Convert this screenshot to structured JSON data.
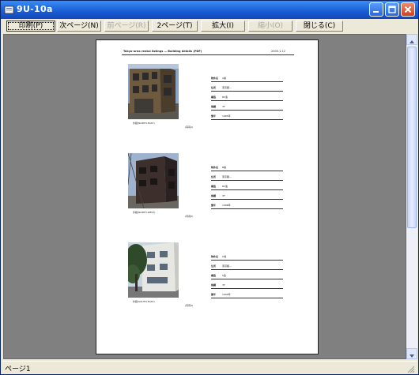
{
  "window": {
    "title": "9U-10a"
  },
  "toolbar": {
    "buttons": [
      {
        "label": "印刷(P)",
        "state": "pressed"
      },
      {
        "label": "次ページ(N)",
        "state": "normal"
      },
      {
        "label": "前ページ(R)",
        "state": "disabled"
      },
      {
        "label": "2ページ(T)",
        "state": "normal"
      },
      {
        "label": "拡大(I)",
        "state": "normal"
      },
      {
        "label": "縮小(O)",
        "state": "disabled"
      },
      {
        "label": "閉じる(C)",
        "state": "normal"
      }
    ]
  },
  "page": {
    "header": "Tokyo-area rental listings — Building details (PDF)",
    "date": "2005.1.12",
    "listings": [
      {
        "photo": "brown-concrete-building",
        "caption": "外観(NORTH-EAST)",
        "caption2": "(写真1)",
        "fields": [
          {
            "label": "物件名",
            "value": "A棟"
          },
          {
            "label": "住所",
            "value": "東京都—"
          },
          {
            "label": "構造",
            "value": "RC造"
          },
          {
            "label": "規模",
            "value": "3F"
          },
          {
            "label": "築年",
            "value": "1985年"
          }
        ]
      },
      {
        "photo": "dark-brick-building",
        "caption": "外観(NORTH-WEST)",
        "caption2": "(写真2)",
        "fields": [
          {
            "label": "物件名",
            "value": "B棟"
          },
          {
            "label": "住所",
            "value": "東京都—"
          },
          {
            "label": "構造",
            "value": "RC造"
          },
          {
            "label": "規模",
            "value": "3F"
          },
          {
            "label": "築年",
            "value": "1988年"
          }
        ]
      },
      {
        "photo": "white-building-with-tree",
        "caption": "外観(SOUTH-EAST)",
        "caption2": "(写真3)",
        "fields": [
          {
            "label": "物件名",
            "value": "C棟"
          },
          {
            "label": "住所",
            "value": "東京都—"
          },
          {
            "label": "構造",
            "value": "S造"
          },
          {
            "label": "規模",
            "value": "3F"
          },
          {
            "label": "築年",
            "value": "1990年"
          }
        ]
      }
    ]
  },
  "status": {
    "text": "ページ1"
  },
  "colors": {
    "titlebar": "#1a5fd8",
    "close": "#d0401e",
    "viewer_bg": "#808080",
    "chrome": "#ece9d8"
  }
}
